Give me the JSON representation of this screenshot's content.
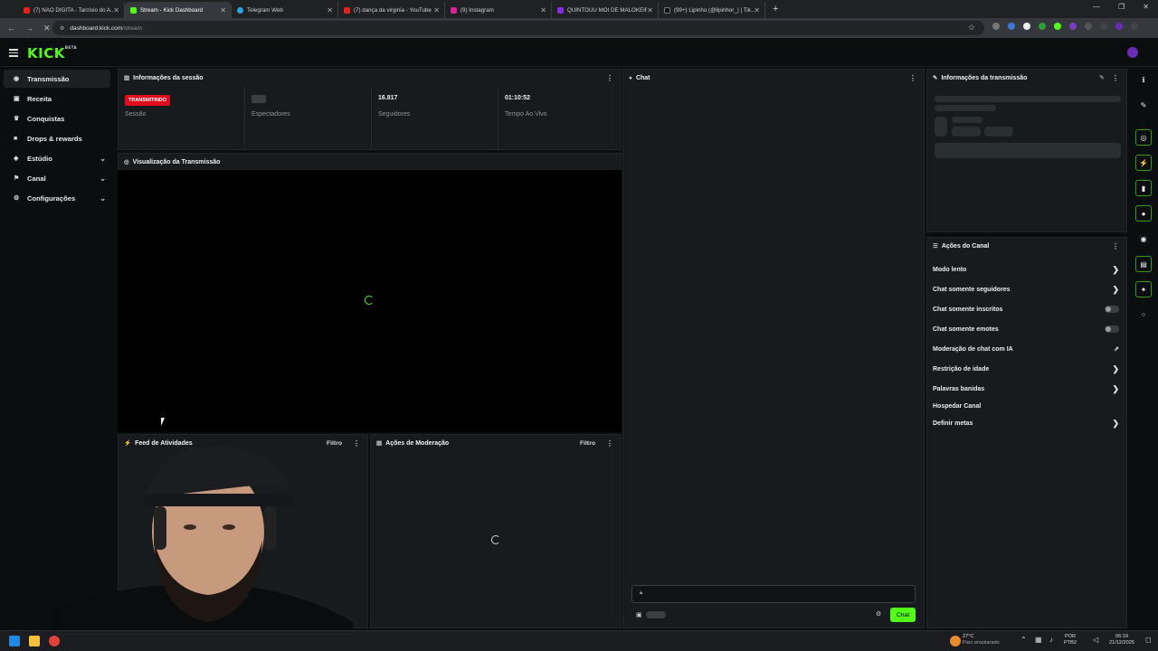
{
  "browser": {
    "tabs": [
      {
        "title": "(7) NÃO DIGITA - Tarcísio do A...",
        "color": "#e62117"
      },
      {
        "title": "Stream - Kick Dashboard",
        "color": "#53fc18",
        "active": true
      },
      {
        "title": "Telegram Web",
        "color": "#2aa3df"
      },
      {
        "title": "(7) dança da virginia - YouTube",
        "color": "#e62117"
      },
      {
        "title": "(9) Instagram",
        "color": "#d6249f"
      },
      {
        "title": "QUINTOUU MOI DE MALOKEIR...",
        "color": "#8a2be2"
      },
      {
        "title": "(99+) Lipinho (@lipinhor_) | Tik...",
        "color": "#111111"
      }
    ],
    "url_host": "dashboard.kick.com",
    "url_path": "/stream"
  },
  "app": {
    "logo": "KICK",
    "logo_tag": "BETA"
  },
  "sidebar": {
    "items": [
      {
        "label": "Transmissão",
        "icon": "broadcast-icon"
      },
      {
        "label": "Receita",
        "icon": "money-icon"
      },
      {
        "label": "Conquistas",
        "icon": "trophy-icon"
      },
      {
        "label": "Drops & rewards",
        "icon": "gift-icon"
      },
      {
        "label": "Estúdio",
        "icon": "studio-icon"
      },
      {
        "label": "Canal",
        "icon": "channel-icon"
      },
      {
        "label": "Configurações",
        "icon": "gear-icon"
      }
    ]
  },
  "session": {
    "title": "Informações da sessão",
    "status_badge": "TRANSMITINDO",
    "status_label": "Sessão",
    "viewers_label": "Espectadores",
    "followers_value": "16.817",
    "followers_label": "Seguidores",
    "live_time_value": "01:10:52",
    "live_time_label": "Tempo Ao Vivo"
  },
  "preview": {
    "title": "Visualização da Transmissão"
  },
  "activity": {
    "title": "Feed de Atividades",
    "filter": "Filtro"
  },
  "moderation": {
    "title": "Ações de Moderação",
    "filter": "Filtro"
  },
  "chat": {
    "title": "Chat",
    "send_label": "Chat"
  },
  "stream_info": {
    "title": "Informações da transmissão"
  },
  "channel_actions": {
    "title": "Ações do Canal",
    "items": [
      {
        "label": "Modo lento",
        "control": "chevron"
      },
      {
        "label": "Chat somente seguidores",
        "control": "chevron"
      },
      {
        "label": "Chat somente inscritos",
        "control": "toggle"
      },
      {
        "label": "Chat somente emotes",
        "control": "toggle"
      },
      {
        "label": "Moderação de chat com IA",
        "control": "external"
      },
      {
        "label": "Restrição de idade",
        "control": "chevron"
      },
      {
        "label": "Palavras banidas",
        "control": "chevron"
      },
      {
        "label": "Hospedar Canal",
        "control": "none"
      },
      {
        "label": "Definir metas",
        "control": "chevron"
      }
    ]
  },
  "taskbar": {
    "weather_temp": "27°C",
    "weather_desc": "Parc ensolarado",
    "lang": "POR",
    "lang_sub": "PTB2",
    "time": "06:19",
    "date": "21/12/2025"
  },
  "colors": {
    "accent": "#53fc18",
    "live": "#e00c1c",
    "bg": "#0b0e0f",
    "panel": "#171b1d"
  }
}
